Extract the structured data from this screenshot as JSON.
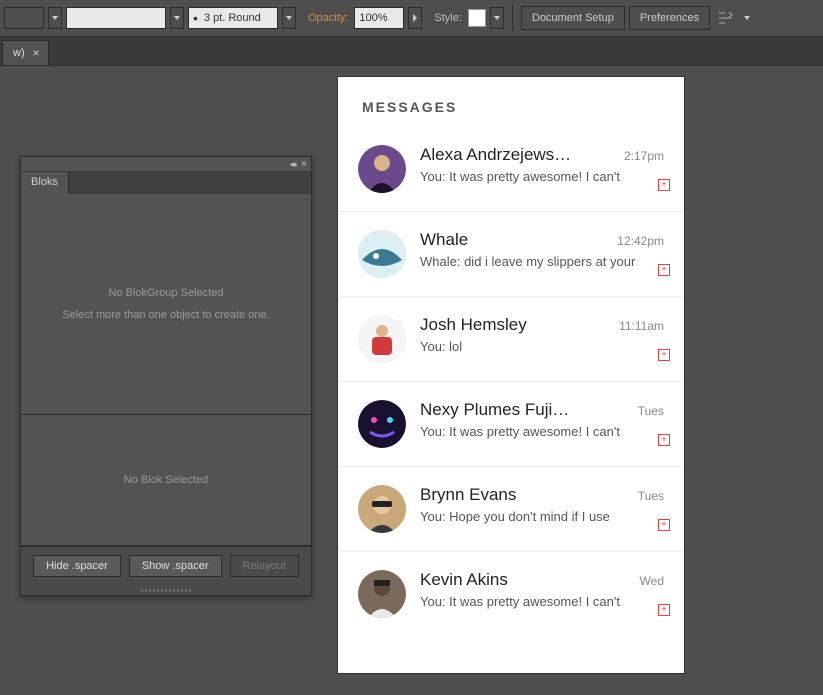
{
  "toolbar": {
    "stroke_label": "3 pt. Round",
    "opacity_label": "Opacity:",
    "opacity_value": "100%",
    "style_label": "Style:",
    "doc_setup": "Document Setup",
    "preferences": "Preferences"
  },
  "doc_tab": {
    "label": "w)"
  },
  "panel": {
    "tab": "Bloks",
    "section1_line1": "No BlokGroup Selected",
    "section1_line2": "Select more than one object to create one.",
    "section2_line1": "No Blok Selected",
    "btn_hide": "Hide .spacer",
    "btn_show": "Show .spacer",
    "btn_relayout": "Relayout"
  },
  "messages": {
    "title": "MESSAGES",
    "items": [
      {
        "name": "Alexa Andrzejews…",
        "time": "2:17pm",
        "preview": "You: It was pretty awesome! I can't"
      },
      {
        "name": "Whale",
        "time": "12:42pm",
        "preview": "Whale: did i leave my slippers at your"
      },
      {
        "name": "Josh Hemsley",
        "time": "11:11am",
        "preview": "You: lol"
      },
      {
        "name": "Nexy Plumes Fuji…",
        "time": "Tues",
        "preview": "You: It was pretty awesome! I can't"
      },
      {
        "name": "Brynn Evans",
        "time": "Tues",
        "preview": "You: Hope you don't mind if I use"
      },
      {
        "name": "Kevin Akins",
        "time": "Wed",
        "preview": "You: It was pretty awesome! I can't"
      }
    ]
  }
}
